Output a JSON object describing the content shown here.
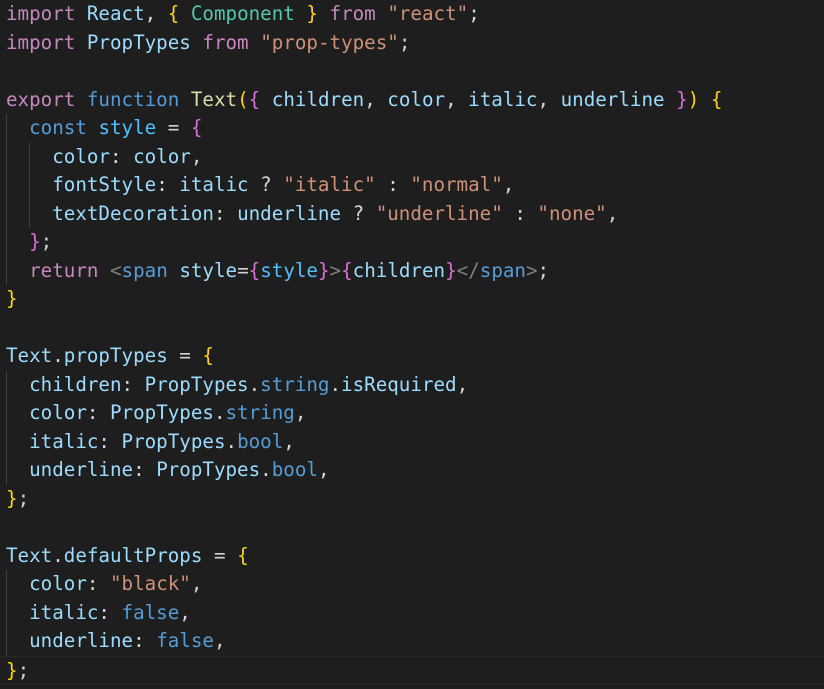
{
  "colors": {
    "background": "#1e1e1e",
    "keyword_control": "#c586c0",
    "keyword": "#569cd6",
    "variable": "#9cdcfe",
    "type": "#4ec9b0",
    "string": "#ce9178",
    "function": "#dcdcaa",
    "bracket_level1": "#ffd700",
    "bracket_level2": "#da70d6",
    "bracket_level3": "#179fff",
    "jsx_tag_bracket": "#808080"
  },
  "code_lines": [
    {
      "indent_guides": 0,
      "tokens": [
        {
          "t": "import",
          "c": "kw-ctrl"
        },
        {
          "t": " ",
          "c": "punc"
        },
        {
          "t": "React",
          "c": "var"
        },
        {
          "t": ", ",
          "c": "punc"
        },
        {
          "t": "{",
          "c": "br1"
        },
        {
          "t": " ",
          "c": "punc"
        },
        {
          "t": "Component",
          "c": "type"
        },
        {
          "t": " ",
          "c": "punc"
        },
        {
          "t": "}",
          "c": "br1"
        },
        {
          "t": " ",
          "c": "punc"
        },
        {
          "t": "from",
          "c": "kw-ctrl"
        },
        {
          "t": " ",
          "c": "punc"
        },
        {
          "t": "\"react\"",
          "c": "str"
        },
        {
          "t": ";",
          "c": "punc"
        }
      ]
    },
    {
      "indent_guides": 0,
      "tokens": [
        {
          "t": "import",
          "c": "kw-ctrl"
        },
        {
          "t": " ",
          "c": "punc"
        },
        {
          "t": "PropTypes",
          "c": "var"
        },
        {
          "t": " ",
          "c": "punc"
        },
        {
          "t": "from",
          "c": "kw-ctrl"
        },
        {
          "t": " ",
          "c": "punc"
        },
        {
          "t": "\"prop-types\"",
          "c": "str"
        },
        {
          "t": ";",
          "c": "punc"
        }
      ]
    },
    {
      "indent_guides": 0,
      "tokens": []
    },
    {
      "indent_guides": 0,
      "tokens": [
        {
          "t": "export",
          "c": "kw-ctrl"
        },
        {
          "t": " ",
          "c": "punc"
        },
        {
          "t": "function",
          "c": "kw"
        },
        {
          "t": " ",
          "c": "punc"
        },
        {
          "t": "Text",
          "c": "fn"
        },
        {
          "t": "(",
          "c": "br1"
        },
        {
          "t": "{",
          "c": "br2"
        },
        {
          "t": " ",
          "c": "punc"
        },
        {
          "t": "children",
          "c": "var"
        },
        {
          "t": ", ",
          "c": "punc"
        },
        {
          "t": "color",
          "c": "var"
        },
        {
          "t": ", ",
          "c": "punc"
        },
        {
          "t": "italic",
          "c": "var"
        },
        {
          "t": ", ",
          "c": "punc"
        },
        {
          "t": "underline",
          "c": "var"
        },
        {
          "t": " ",
          "c": "punc"
        },
        {
          "t": "}",
          "c": "br2"
        },
        {
          "t": ")",
          "c": "br1"
        },
        {
          "t": " ",
          "c": "punc"
        },
        {
          "t": "{",
          "c": "br1"
        }
      ]
    },
    {
      "indent_guides": 1,
      "tokens": [
        {
          "t": "  ",
          "c": "punc"
        },
        {
          "t": "const",
          "c": "kw"
        },
        {
          "t": " ",
          "c": "punc"
        },
        {
          "t": "style",
          "c": "const"
        },
        {
          "t": " = ",
          "c": "punc"
        },
        {
          "t": "{",
          "c": "br2"
        }
      ]
    },
    {
      "indent_guides": 2,
      "tokens": [
        {
          "t": "    ",
          "c": "punc"
        },
        {
          "t": "color",
          "c": "prop"
        },
        {
          "t": ": ",
          "c": "punc"
        },
        {
          "t": "color",
          "c": "var"
        },
        {
          "t": ",",
          "c": "punc"
        }
      ]
    },
    {
      "indent_guides": 2,
      "tokens": [
        {
          "t": "    ",
          "c": "punc"
        },
        {
          "t": "fontStyle",
          "c": "prop"
        },
        {
          "t": ": ",
          "c": "punc"
        },
        {
          "t": "italic",
          "c": "var"
        },
        {
          "t": " ? ",
          "c": "punc"
        },
        {
          "t": "\"italic\"",
          "c": "str"
        },
        {
          "t": " : ",
          "c": "punc"
        },
        {
          "t": "\"normal\"",
          "c": "str"
        },
        {
          "t": ",",
          "c": "punc"
        }
      ]
    },
    {
      "indent_guides": 2,
      "tokens": [
        {
          "t": "    ",
          "c": "punc"
        },
        {
          "t": "textDecoration",
          "c": "prop"
        },
        {
          "t": ": ",
          "c": "punc"
        },
        {
          "t": "underline",
          "c": "var"
        },
        {
          "t": " ? ",
          "c": "punc"
        },
        {
          "t": "\"underline\"",
          "c": "str"
        },
        {
          "t": " : ",
          "c": "punc"
        },
        {
          "t": "\"none\"",
          "c": "str"
        },
        {
          "t": ",",
          "c": "punc"
        }
      ]
    },
    {
      "indent_guides": 1,
      "tokens": [
        {
          "t": "  ",
          "c": "punc"
        },
        {
          "t": "}",
          "c": "br2"
        },
        {
          "t": ";",
          "c": "punc"
        }
      ]
    },
    {
      "indent_guides": 1,
      "tokens": [
        {
          "t": "  ",
          "c": "punc"
        },
        {
          "t": "return",
          "c": "kw-ctrl"
        },
        {
          "t": " ",
          "c": "punc"
        },
        {
          "t": "<",
          "c": "tag"
        },
        {
          "t": "span",
          "c": "tagname"
        },
        {
          "t": " ",
          "c": "punc"
        },
        {
          "t": "style",
          "c": "var"
        },
        {
          "t": "=",
          "c": "punc"
        },
        {
          "t": "{",
          "c": "br2"
        },
        {
          "t": "style",
          "c": "const"
        },
        {
          "t": "}",
          "c": "br2"
        },
        {
          "t": ">",
          "c": "tag"
        },
        {
          "t": "{",
          "c": "br2"
        },
        {
          "t": "children",
          "c": "var"
        },
        {
          "t": "}",
          "c": "br2"
        },
        {
          "t": "</",
          "c": "tag"
        },
        {
          "t": "span",
          "c": "tagname"
        },
        {
          "t": ">",
          "c": "tag"
        },
        {
          "t": ";",
          "c": "punc"
        }
      ]
    },
    {
      "indent_guides": 0,
      "tokens": [
        {
          "t": "}",
          "c": "br1"
        }
      ]
    },
    {
      "indent_guides": 0,
      "tokens": []
    },
    {
      "indent_guides": 0,
      "tokens": [
        {
          "t": "Text",
          "c": "var"
        },
        {
          "t": ".",
          "c": "punc"
        },
        {
          "t": "propTypes",
          "c": "var"
        },
        {
          "t": " = ",
          "c": "punc"
        },
        {
          "t": "{",
          "c": "br1"
        }
      ]
    },
    {
      "indent_guides": 1,
      "tokens": [
        {
          "t": "  ",
          "c": "punc"
        },
        {
          "t": "children",
          "c": "prop"
        },
        {
          "t": ": ",
          "c": "punc"
        },
        {
          "t": "PropTypes",
          "c": "var"
        },
        {
          "t": ".",
          "c": "punc"
        },
        {
          "t": "string",
          "c": "kw"
        },
        {
          "t": ".",
          "c": "punc"
        },
        {
          "t": "isRequired",
          "c": "var"
        },
        {
          "t": ",",
          "c": "punc"
        }
      ]
    },
    {
      "indent_guides": 1,
      "tokens": [
        {
          "t": "  ",
          "c": "punc"
        },
        {
          "t": "color",
          "c": "prop"
        },
        {
          "t": ": ",
          "c": "punc"
        },
        {
          "t": "PropTypes",
          "c": "var"
        },
        {
          "t": ".",
          "c": "punc"
        },
        {
          "t": "string",
          "c": "kw"
        },
        {
          "t": ",",
          "c": "punc"
        }
      ]
    },
    {
      "indent_guides": 1,
      "tokens": [
        {
          "t": "  ",
          "c": "punc"
        },
        {
          "t": "italic",
          "c": "prop"
        },
        {
          "t": ": ",
          "c": "punc"
        },
        {
          "t": "PropTypes",
          "c": "var"
        },
        {
          "t": ".",
          "c": "punc"
        },
        {
          "t": "bool",
          "c": "kw"
        },
        {
          "t": ",",
          "c": "punc"
        }
      ]
    },
    {
      "indent_guides": 1,
      "tokens": [
        {
          "t": "  ",
          "c": "punc"
        },
        {
          "t": "underline",
          "c": "prop"
        },
        {
          "t": ": ",
          "c": "punc"
        },
        {
          "t": "PropTypes",
          "c": "var"
        },
        {
          "t": ".",
          "c": "punc"
        },
        {
          "t": "bool",
          "c": "kw"
        },
        {
          "t": ",",
          "c": "punc"
        }
      ]
    },
    {
      "indent_guides": 0,
      "tokens": [
        {
          "t": "}",
          "c": "br1"
        },
        {
          "t": ";",
          "c": "punc"
        }
      ]
    },
    {
      "indent_guides": 0,
      "tokens": []
    },
    {
      "indent_guides": 0,
      "tokens": [
        {
          "t": "Text",
          "c": "var"
        },
        {
          "t": ".",
          "c": "punc"
        },
        {
          "t": "defaultProps",
          "c": "var"
        },
        {
          "t": " = ",
          "c": "punc"
        },
        {
          "t": "{",
          "c": "br1"
        }
      ]
    },
    {
      "indent_guides": 1,
      "tokens": [
        {
          "t": "  ",
          "c": "punc"
        },
        {
          "t": "color",
          "c": "prop"
        },
        {
          "t": ": ",
          "c": "punc"
        },
        {
          "t": "\"black\"",
          "c": "str"
        },
        {
          "t": ",",
          "c": "punc"
        }
      ]
    },
    {
      "indent_guides": 1,
      "tokens": [
        {
          "t": "  ",
          "c": "punc"
        },
        {
          "t": "italic",
          "c": "prop"
        },
        {
          "t": ": ",
          "c": "punc"
        },
        {
          "t": "false",
          "c": "kw"
        },
        {
          "t": ",",
          "c": "punc"
        }
      ]
    },
    {
      "indent_guides": 1,
      "tokens": [
        {
          "t": "  ",
          "c": "punc"
        },
        {
          "t": "underline",
          "c": "prop"
        },
        {
          "t": ": ",
          "c": "punc"
        },
        {
          "t": "false",
          "c": "kw"
        },
        {
          "t": ",",
          "c": "punc"
        }
      ]
    },
    {
      "indent_guides": 0,
      "current": true,
      "tokens": [
        {
          "t": "}",
          "c": "br1"
        },
        {
          "t": ";",
          "c": "punc"
        }
      ]
    }
  ]
}
